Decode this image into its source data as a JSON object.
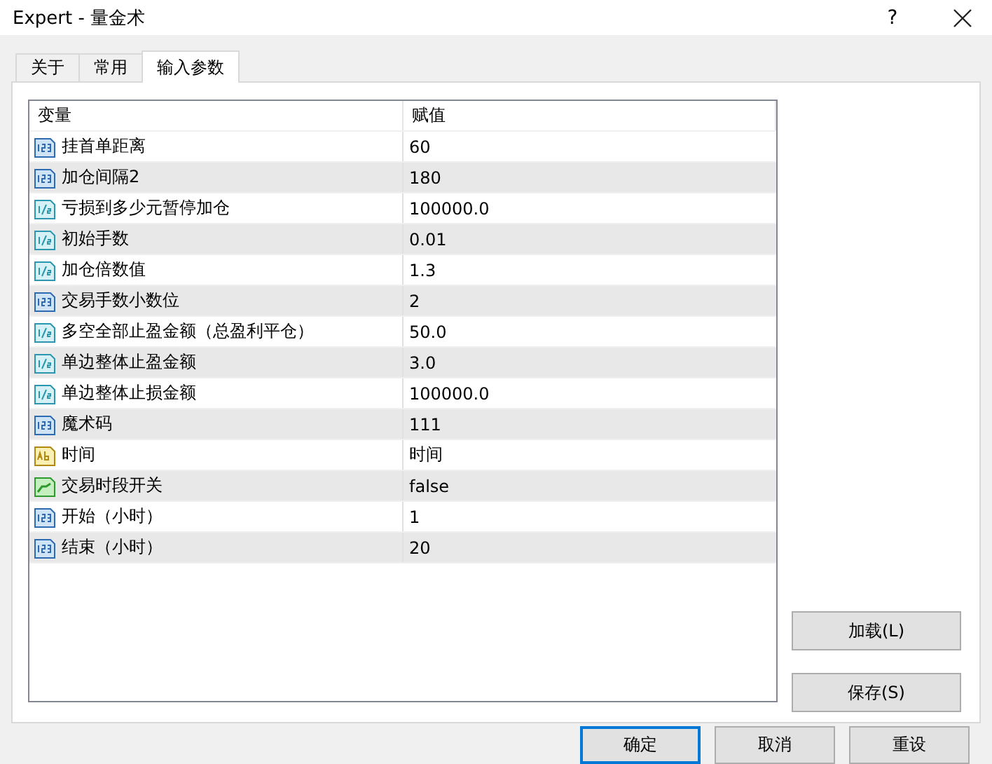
{
  "window": {
    "title": "Expert - 量金术",
    "help": "?"
  },
  "tabs": [
    {
      "label": "关于",
      "selected": false
    },
    {
      "label": "常用",
      "selected": false
    },
    {
      "label": "输入参数",
      "selected": true
    }
  ],
  "table": {
    "columns": [
      "变量",
      "赋值"
    ],
    "rows": [
      {
        "kind": "int",
        "name": "挂首单距离",
        "value": "60"
      },
      {
        "kind": "int",
        "name": "加仓间隔2",
        "value": "180"
      },
      {
        "kind": "double",
        "name": "亏损到多少元暂停加仓",
        "value": "100000.0"
      },
      {
        "kind": "double",
        "name": "初始手数",
        "value": "0.01"
      },
      {
        "kind": "double",
        "name": "加仓倍数值",
        "value": "1.3"
      },
      {
        "kind": "int",
        "name": "交易手数小数位",
        "value": "2"
      },
      {
        "kind": "double",
        "name": "多空全部止盈金额（总盈利平仓）",
        "value": "50.0"
      },
      {
        "kind": "double",
        "name": "单边整体止盈金额",
        "value": "3.0"
      },
      {
        "kind": "double",
        "name": "单边整体止损金额",
        "value": "100000.0"
      },
      {
        "kind": "int",
        "name": "魔术码",
        "value": "111"
      },
      {
        "kind": "string",
        "name": "时间",
        "value": "时间"
      },
      {
        "kind": "bool",
        "name": "交易时段开关",
        "value": "false"
      },
      {
        "kind": "int",
        "name": "开始（小时）",
        "value": "1"
      },
      {
        "kind": "int",
        "name": "结束（小时）",
        "value": "20"
      }
    ]
  },
  "side_buttons": [
    "加载(L)",
    "保存(S)"
  ],
  "buttons": [
    {
      "label": "确定",
      "default": true
    },
    {
      "label": "取消",
      "default": false
    },
    {
      "label": "重设",
      "default": false
    }
  ]
}
